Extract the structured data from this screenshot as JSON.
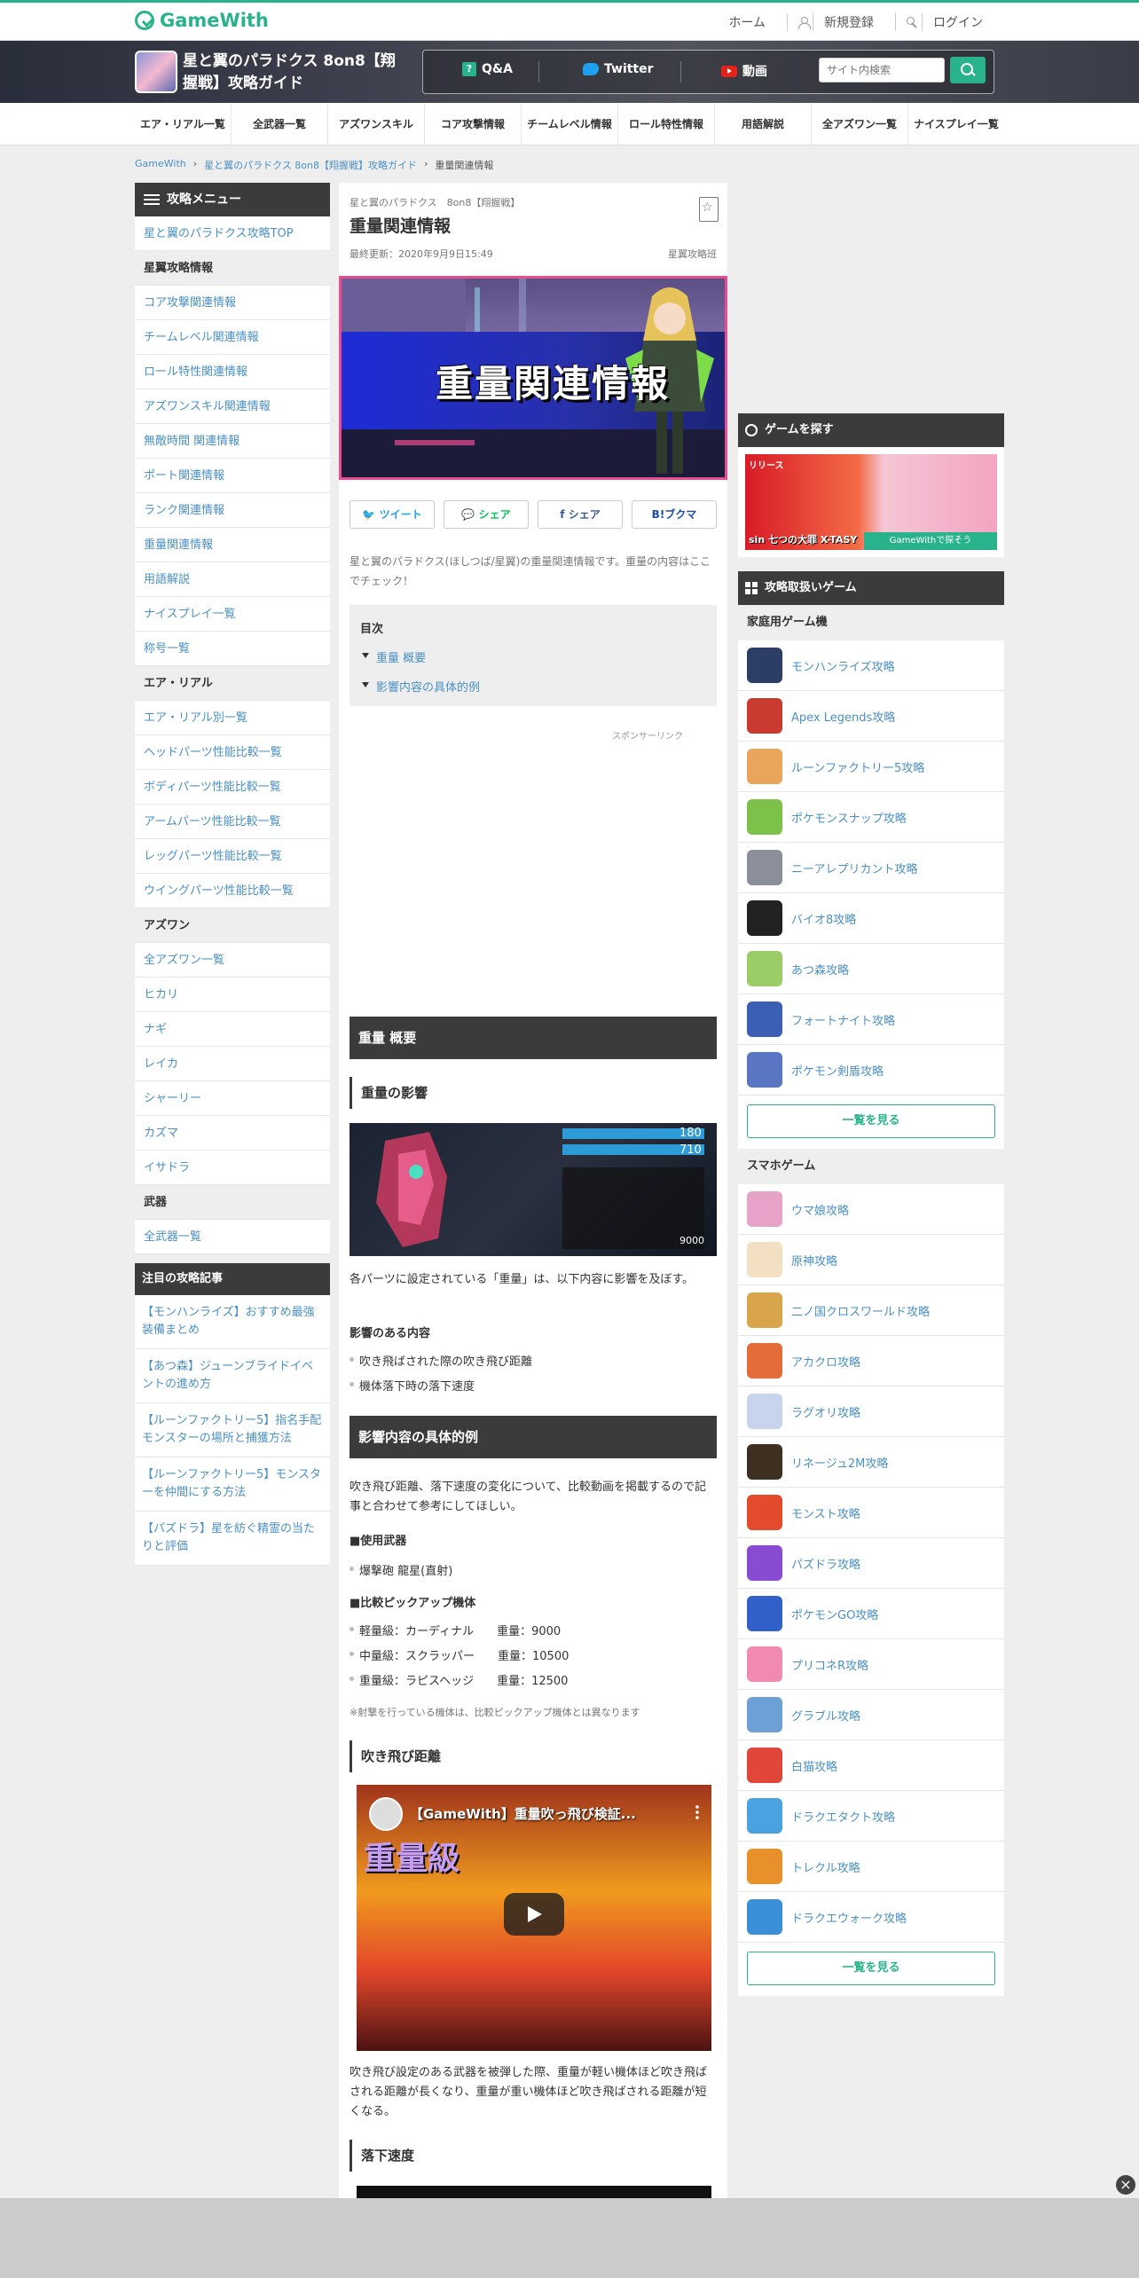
{
  "header": {
    "logo": "GameWith",
    "links": [
      "ホーム",
      "新規登録",
      "ログイン"
    ]
  },
  "gamebar": {
    "title": "星と翼のパラドクス 8on8【翔握戦】攻略ガイド",
    "nav": [
      "Q&A",
      "Twitter",
      "動画"
    ],
    "search_placeholder": "サイト内検索"
  },
  "catnav": [
    "エア・リアル一覧",
    "全武器一覧",
    "アズワンスキル",
    "コア攻撃情報",
    "チームレベル情報",
    "ロール特性情報",
    "用語解説",
    "全アズワン一覧",
    "ナイスプレイ一覧"
  ],
  "breadcrumb": [
    "GameWith",
    "星と翼のパラドクス 8on8【翔握戦】攻略ガイド",
    "重量関連情報"
  ],
  "leftmenu": {
    "title": "攻略メニュー",
    "items": [
      {
        "label": "星と翼のパラドクス攻略TOP",
        "cat": false
      },
      {
        "label": "星翼攻略情報",
        "cat": true
      },
      {
        "label": "コア攻撃関連情報",
        "cat": false
      },
      {
        "label": "チームレベル関連情報",
        "cat": false
      },
      {
        "label": "ロール特性関連情報",
        "cat": false
      },
      {
        "label": "アズワンスキル関連情報",
        "cat": false
      },
      {
        "label": "無敵時間 関連情報",
        "cat": false
      },
      {
        "label": "ポート関連情報",
        "cat": false
      },
      {
        "label": "ランク関連情報",
        "cat": false
      },
      {
        "label": "重量関連情報",
        "cat": false
      },
      {
        "label": "用語解説",
        "cat": false
      },
      {
        "label": "ナイスプレイ一覧",
        "cat": false
      },
      {
        "label": "称号一覧",
        "cat": false
      },
      {
        "label": "エア・リアル",
        "cat": true
      },
      {
        "label": "エア・リアル別一覧",
        "cat": false
      },
      {
        "label": "ヘッドパーツ性能比較一覧",
        "cat": false
      },
      {
        "label": "ボディパーツ性能比較一覧",
        "cat": false
      },
      {
        "label": "アームパーツ性能比較一覧",
        "cat": false
      },
      {
        "label": "レッグパーツ性能比較一覧",
        "cat": false
      },
      {
        "label": "ウイングパーツ性能比較一覧",
        "cat": false
      },
      {
        "label": "アズワン",
        "cat": true
      },
      {
        "label": "全アズワン一覧",
        "cat": false
      },
      {
        "label": "ヒカリ",
        "cat": false
      },
      {
        "label": "ナギ",
        "cat": false
      },
      {
        "label": "レイカ",
        "cat": false
      },
      {
        "label": "シャーリー",
        "cat": false
      },
      {
        "label": "カズマ",
        "cat": false
      },
      {
        "label": "イサドラ",
        "cat": false
      },
      {
        "label": "武器",
        "cat": true
      },
      {
        "label": "全武器一覧",
        "cat": false
      }
    ]
  },
  "attention": {
    "title": "注目の攻略記事",
    "items": [
      "【モンハンライズ】おすすめ最強装備まとめ",
      "【あつ森】ジューンブライドイベントの進め方",
      "【ルーンファクトリー5】指名手配モンスターの場所と捕獲方法",
      "【ルーンファクトリー5】モンスターを仲間にする方法",
      "【パズドラ】星を紡ぐ精霊の当たりと評価"
    ]
  },
  "article": {
    "pre_title": "星と翼のパラドクス　8on8【翔握戦】",
    "title": "重量関連情報",
    "updated": "最終更新：2020年9月9日15:49",
    "author": "星翼攻略班",
    "banner_text": "重量関連情報",
    "share": [
      "ツイート",
      "シェア",
      "シェア",
      "ブクマ"
    ],
    "intro": "星と翼のパラドクス(ほしつば/星翼)の重量関連情報です。重量の内容はここでチェック！",
    "toc_title": "目次",
    "toc": [
      "重量 概要",
      "影響内容の具体的例"
    ],
    "sponsor": "スポンサーリンク",
    "h2_overview": "重量 概要",
    "h3_effect": "重量の影響",
    "p_effect": "各パーツに設定されている「重量」は、以下内容に影響を及ぼす。",
    "label_affects": "影響のある内容",
    "affects": [
      "吹き飛ばされた際の吹き飛び距離",
      "機体落下時の落下速度"
    ],
    "h2_examples": "影響内容の具体的例",
    "p_examples": "吹き飛び距離、落下速度の変化について、比較動画を掲載するので記事と合わせて参考にしてほしい。",
    "label_weapon": "■使用武器",
    "weapon": "爆撃砲 龍星(直射)",
    "label_units": "■比較ピックアップ機体",
    "units": [
      "軽量級：カーディナル　　重量：9000",
      "中量級：スクラッパー　　重量：10500",
      "重量級：ラピスヘッジ　　重量：12500"
    ],
    "note": "※射撃を行っている機体は、比較ピックアップ機体とは異なります",
    "h3_knockback": "吹き飛び距離",
    "video_title": "【GameWith】重量吹っ飛び検証...",
    "video_caption": "重量級",
    "p_knockback": "吹き飛び設定のある武器を被弾した際、重量が軽い機体ほど吹き飛ばされる距離が長くなり、重量が重い機体ほど吹き飛ばされる距離が短くなる。",
    "h3_fall": "落下速度",
    "screenshot_stats": [
      "180",
      "710",
      "9000"
    ]
  },
  "right": {
    "find_title": "ゲームを探す",
    "ad_left": "リリース",
    "ad_bottom": "sin 七つの大罪 X-TASY",
    "ad_badge": "GameWithで探そう",
    "guides_title": "攻略取扱いゲーム",
    "console_title": "家庭用ゲーム機",
    "console": [
      {
        "label": "モンハンライズ攻略",
        "color": "#2c3e66"
      },
      {
        "label": "Apex Legends攻略",
        "color": "#c93a31"
      },
      {
        "label": "ルーンファクトリー5攻略",
        "color": "#e9a55c"
      },
      {
        "label": "ポケモンスナップ攻略",
        "color": "#7cc24a"
      },
      {
        "label": "ニーアレプリカント攻略",
        "color": "#8a8f99"
      },
      {
        "label": "バイオ8攻略",
        "color": "#222222"
      },
      {
        "label": "あつ森攻略",
        "color": "#9ccc65"
      },
      {
        "label": "フォートナイト攻略",
        "color": "#3a5fb5"
      },
      {
        "label": "ポケモン剣盾攻略",
        "color": "#5a76c2"
      }
    ],
    "more1": "一覧を見る",
    "smart_title": "スマホゲーム",
    "smart": [
      {
        "label": "ウマ娘攻略",
        "color": "#e7a2c8"
      },
      {
        "label": "原神攻略",
        "color": "#f3e0c3"
      },
      {
        "label": "二ノ国クロスワールド攻略",
        "color": "#d9a54a"
      },
      {
        "label": "アカクロ攻略",
        "color": "#e46b3a"
      },
      {
        "label": "ラグオリ攻略",
        "color": "#c8d4ee"
      },
      {
        "label": "リネージュ2M攻略",
        "color": "#3e3020"
      },
      {
        "label": "モンスト攻略",
        "color": "#e24b2b"
      },
      {
        "label": "パズドラ攻略",
        "color": "#8a4bd3"
      },
      {
        "label": "ポケモンGO攻略",
        "color": "#3060c8"
      },
      {
        "label": "プリコネR攻略",
        "color": "#f08ab0"
      },
      {
        "label": "グラブル攻略",
        "color": "#6ca0d6"
      },
      {
        "label": "白猫攻略",
        "color": "#e0473a"
      },
      {
        "label": "ドラクエタクト攻略",
        "color": "#4aa3e0"
      },
      {
        "label": "トレクル攻略",
        "color": "#e8902c"
      },
      {
        "label": "ドラクエウォーク攻略",
        "color": "#3b8ed8"
      }
    ],
    "more2": "一覧を見る"
  }
}
